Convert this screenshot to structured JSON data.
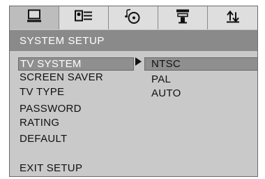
{
  "tabs": [
    {
      "icon": "monitor-icon",
      "active": true
    },
    {
      "icon": "id-card-icon",
      "active": false
    },
    {
      "icon": "music-disc-icon",
      "active": false
    },
    {
      "icon": "speaker-icon",
      "active": false
    },
    {
      "icon": "swap-arrows-icon",
      "active": false
    }
  ],
  "title": "SYSTEM SETUP",
  "menu": {
    "items": [
      "TV SYSTEM",
      "SCREEN SAVER",
      "TV TYPE",
      "PASSWORD",
      "RATING",
      "DEFAULT"
    ],
    "exit": "EXIT SETUP",
    "selected_index": 0
  },
  "options": {
    "items": [
      "NTSC",
      "PAL",
      "AUTO"
    ],
    "selected_index": 0
  },
  "colors": {
    "panel": "#c9c9c9",
    "title_bar": "#8a8a8a",
    "highlight": "#8f8f8f"
  }
}
